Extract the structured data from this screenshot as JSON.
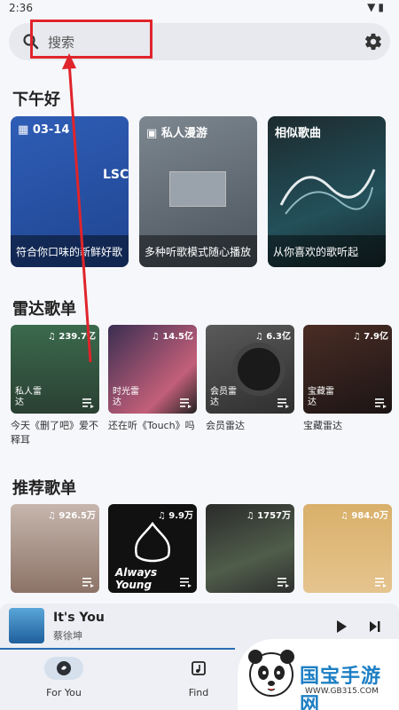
{
  "status_bar": {
    "time": "2:36"
  },
  "search": {
    "placeholder": "搜索"
  },
  "greeting": "下午好",
  "featured": [
    {
      "head": "03-14",
      "cover_text": "LSC",
      "footer": "符合你口味的新鲜好歌"
    },
    {
      "head": "私人漫游",
      "cover_text": "",
      "footer": "多种听歌模式随心播放"
    },
    {
      "head": "相似歌曲",
      "cover_text": "",
      "footer": "从你喜欢的歌听起"
    }
  ],
  "radar": {
    "title": "雷达歌单",
    "items": [
      {
        "count": "239.7亿",
        "tag": "私人雷达",
        "caption": "今天《删了吧》爱不释耳"
      },
      {
        "count": "14.5亿",
        "tag": "时光雷达",
        "caption": "还在听《Touch》吗"
      },
      {
        "count": "6.3亿",
        "tag": "会员雷达",
        "caption": "会员雷达"
      },
      {
        "count": "7.9亿",
        "tag": "宝藏雷达",
        "caption": "宝藏雷达"
      }
    ]
  },
  "recommended": {
    "title": "推荐歌单",
    "items": [
      {
        "count": "926.5万",
        "art_text": ""
      },
      {
        "count": "9.9万",
        "art_text": "Always Young"
      },
      {
        "count": "1757万",
        "art_text": ""
      },
      {
        "count": "984.0万",
        "art_text": ""
      }
    ]
  },
  "player": {
    "song": "It's You",
    "artist": "蔡徐坤"
  },
  "nav": {
    "for_you": "For You",
    "find": "Find"
  },
  "watermark": {
    "brand": "国宝手游网",
    "site": "WWW.GB315.COM"
  },
  "colors": {
    "accent": "#2a6cb4",
    "highlight": "#e0242b",
    "background": "#f6f7fb"
  }
}
